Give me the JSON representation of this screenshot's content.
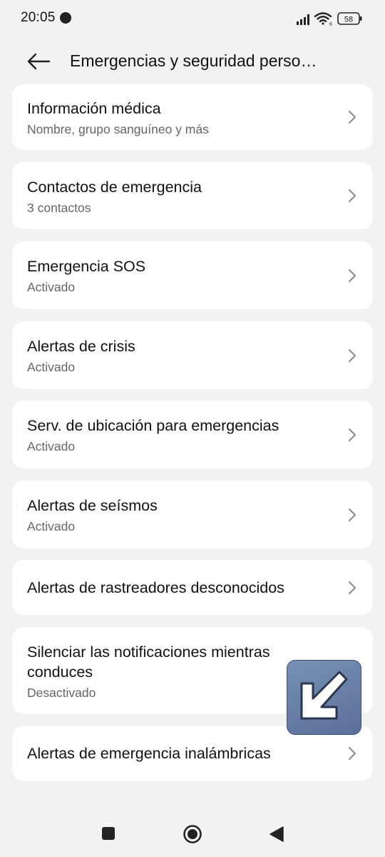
{
  "status_bar": {
    "time": "20:05",
    "battery": "58",
    "icons": [
      "notification-dot-icon",
      "signal-icon",
      "wifi-icon",
      "battery-icon"
    ]
  },
  "header": {
    "title": "Emergencias y seguridad perso…",
    "back_icon": "back-arrow-icon"
  },
  "items": [
    {
      "title": "Información médica",
      "subtitle": "Nombre, grupo sanguíneo y más"
    },
    {
      "title": "Contactos de emergencia",
      "subtitle": "3 contactos"
    },
    {
      "title": "Emergencia SOS",
      "subtitle": "Activado"
    },
    {
      "title": "Alertas de crisis",
      "subtitle": "Activado"
    },
    {
      "title": "Serv. de ubicación para emergencias",
      "subtitle": "Activado"
    },
    {
      "title": "Alertas de seísmos",
      "subtitle": "Activado"
    },
    {
      "title": "Alertas de rastreadores desconocidos"
    },
    {
      "title": "Silenciar las notificaciones mientras conduces",
      "subtitle": "Desactivado"
    },
    {
      "title": "Alertas de emergencia inalámbricas"
    }
  ],
  "overlay": {
    "icon": "diagonal-arrow-icon"
  },
  "nav_bar": {
    "icons": [
      "recents-square-icon",
      "home-circle-icon",
      "back-triangle-icon"
    ]
  },
  "colors": {
    "background": "#f2f2f2",
    "card": "#ffffff",
    "subtitle": "#666666",
    "overlay": "#6a80a8"
  }
}
